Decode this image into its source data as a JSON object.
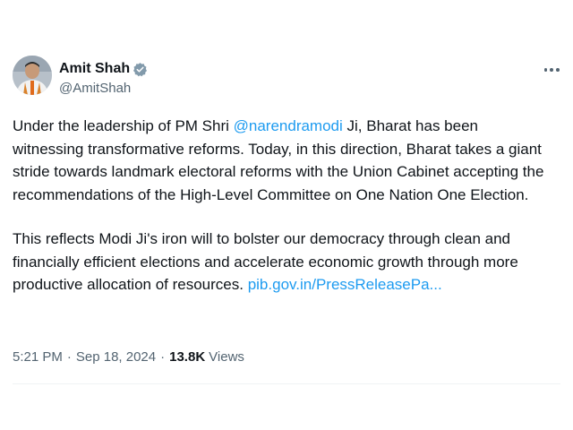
{
  "author": {
    "name": "Amit Shah",
    "handle": "@AmitShah"
  },
  "tweet": {
    "p1_before": "Under the leadership of PM Shri ",
    "p1_mention": "@narendramodi",
    "p1_after": " Ji, Bharat has been witnessing transformative reforms. Today, in this direction, Bharat takes a giant stride towards landmark electoral reforms with the Union Cabinet accepting the recommendations of the High-Level Committee on One Nation One Election.",
    "p2_text": "This reflects Modi Ji's iron will to bolster our democracy through clean and financially efficient elections and accelerate economic growth through more productive allocation of resources. ",
    "p2_link": "pib.gov.in/PressReleasePa..."
  },
  "meta": {
    "time": "5:21 PM",
    "separator": "·",
    "date": "Sep 18, 2024",
    "views_count": "13.8K",
    "views_label": "Views"
  },
  "colors": {
    "link": "#1d9bf0",
    "verified_badge": "#829aab",
    "secondary_text": "#536471"
  },
  "icons": {
    "verified": "verified-badge-icon",
    "more": "more-options-icon"
  }
}
